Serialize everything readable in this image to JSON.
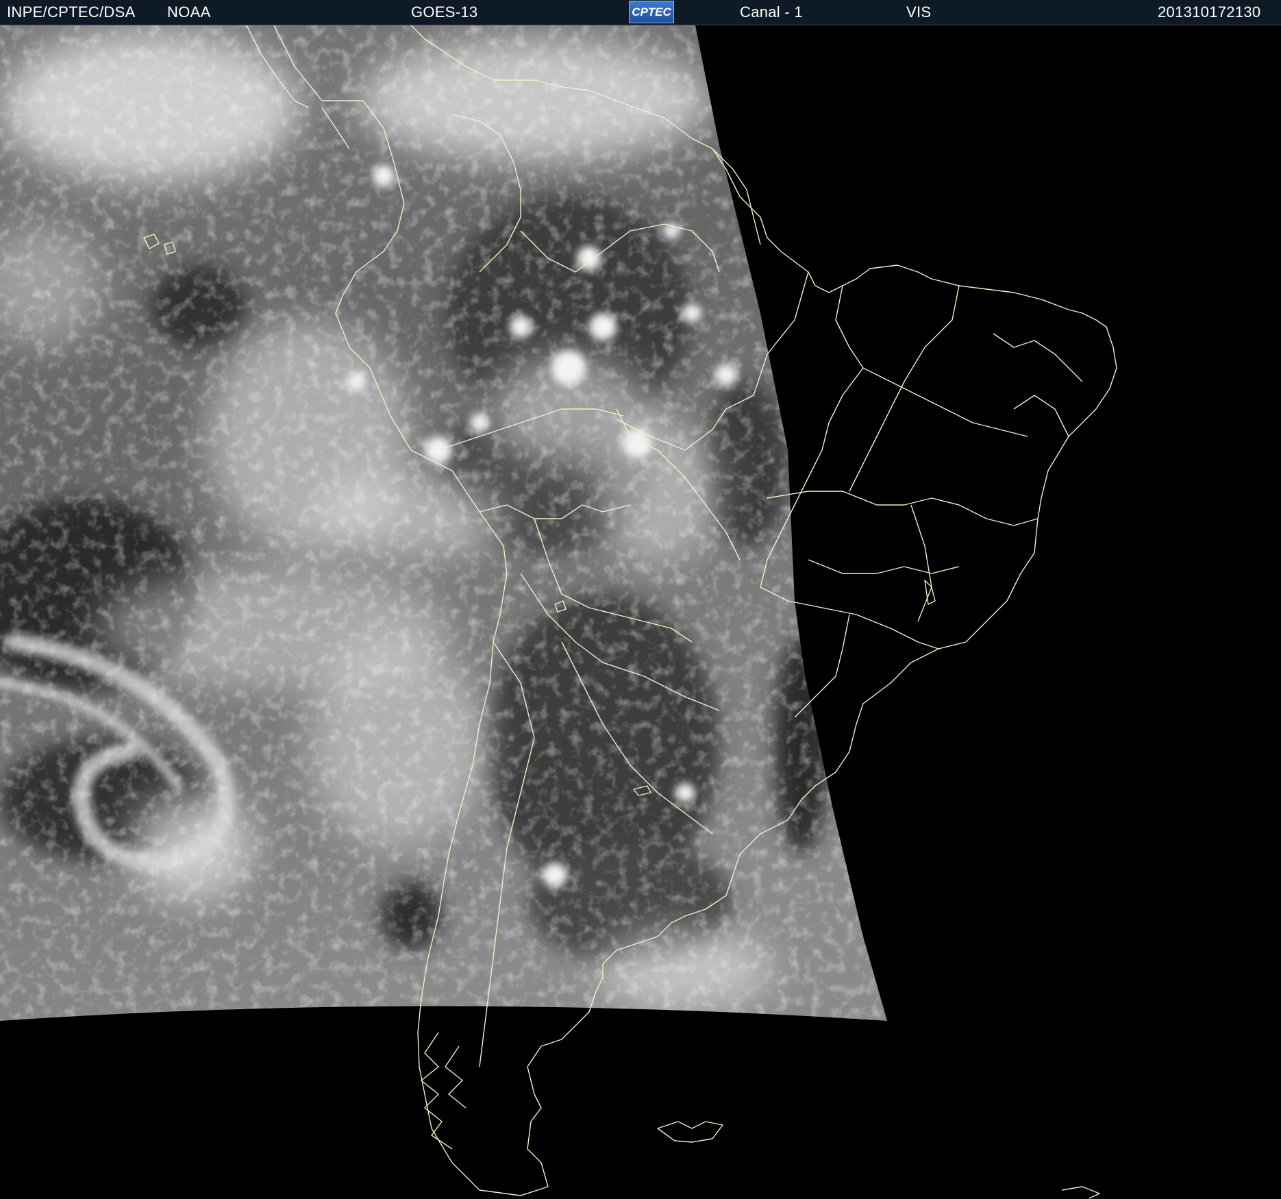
{
  "header": {
    "agency": "INPE/CPTEC/DSA",
    "source": "NOAA",
    "satellite": "GOES-13",
    "logo_text": "CPTEC",
    "channel": "Canal - 1",
    "band": "VIS",
    "timestamp": "201310172130"
  },
  "colors": {
    "header_background": "#0e1a26",
    "boundary_lines": "#f2f0c8",
    "space_background": "#000000"
  },
  "icons": {
    "logo": "cptec-logo"
  }
}
